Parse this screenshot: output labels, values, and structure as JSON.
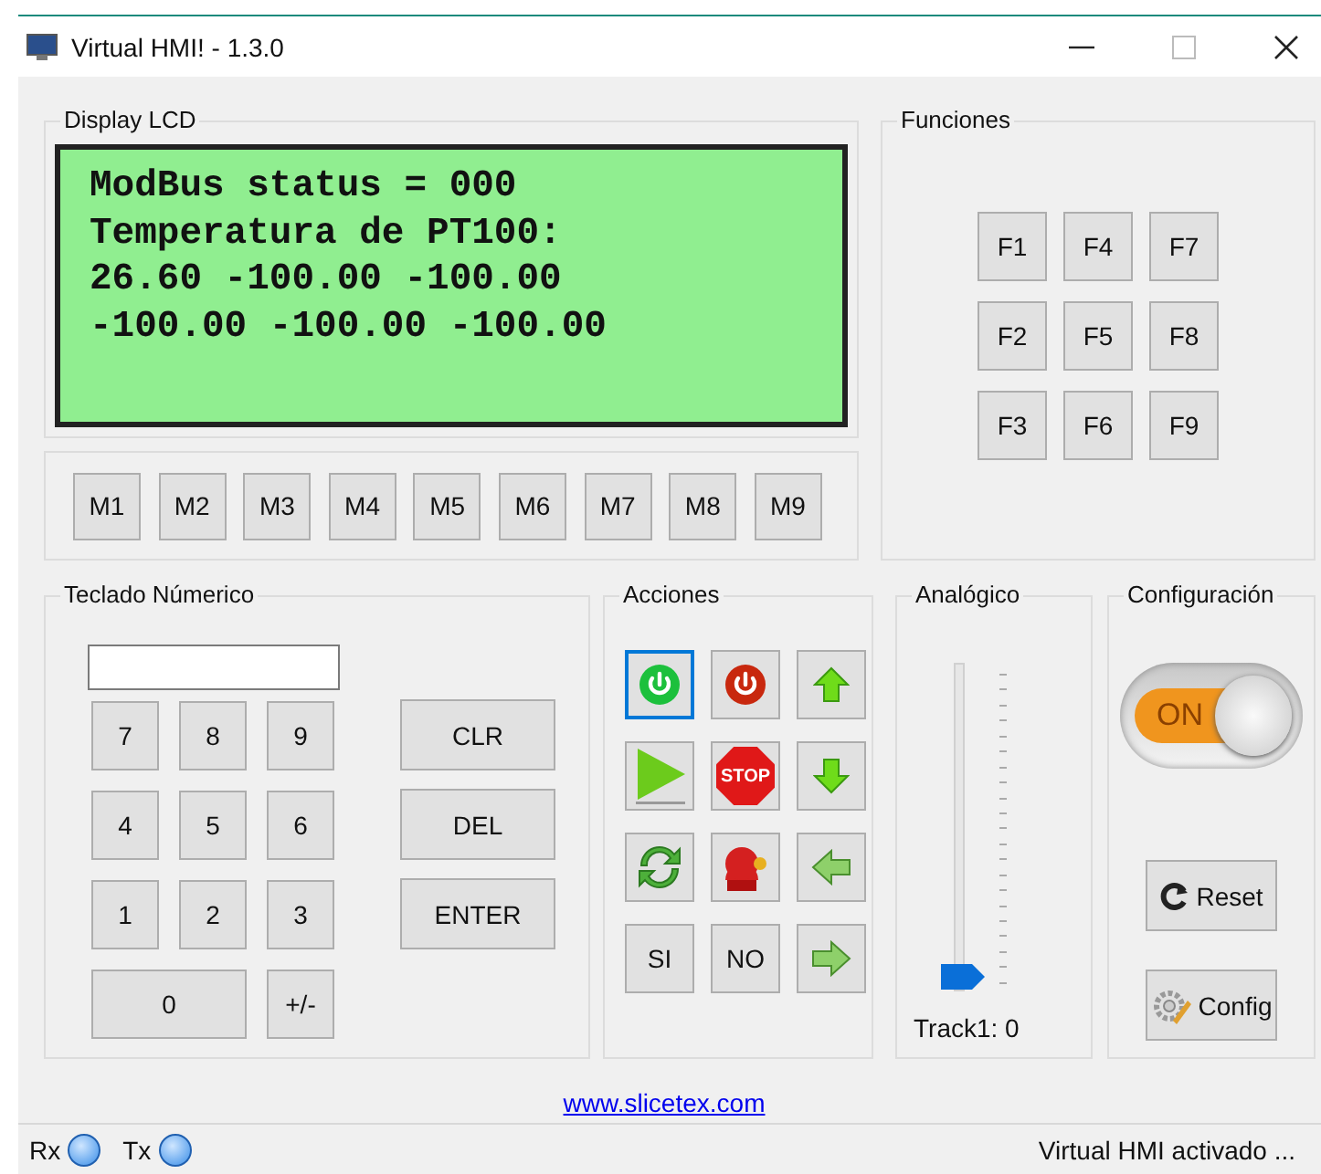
{
  "window": {
    "title": "Virtual HMI! - 1.3.0"
  },
  "display": {
    "title": "Display LCD",
    "lines": [
      "ModBus status = 000",
      "Temperatura de PT100:",
      "26.60 -100.00 -100.00",
      "-100.00 -100.00 -100.00"
    ]
  },
  "memory_buttons": [
    "M1",
    "M2",
    "M3",
    "M4",
    "M5",
    "M6",
    "M7",
    "M8",
    "M9"
  ],
  "functions": {
    "title": "Funciones",
    "buttons": [
      "F1",
      "F4",
      "F7",
      "F2",
      "F5",
      "F8",
      "F3",
      "F6",
      "F9"
    ]
  },
  "keypad": {
    "title": "Teclado Númerico",
    "keys": [
      {
        "label": "7",
        "wide": false
      },
      {
        "label": "8",
        "wide": false
      },
      {
        "label": "9",
        "wide": false
      },
      {
        "label": "4",
        "wide": false
      },
      {
        "label": "5",
        "wide": false
      },
      {
        "label": "6",
        "wide": false
      },
      {
        "label": "1",
        "wide": false
      },
      {
        "label": "2",
        "wide": false
      },
      {
        "label": "3",
        "wide": false
      },
      {
        "label": "0",
        "wide": true
      },
      {
        "label": "+/-",
        "wide": false
      }
    ],
    "side_keys": [
      "CLR",
      "DEL",
      "ENTER"
    ]
  },
  "actions": {
    "title": "Acciones",
    "buttons": [
      {
        "kind": "power_on",
        "focused": true
      },
      {
        "kind": "power_off",
        "focused": false
      },
      {
        "kind": "up",
        "focused": false
      },
      {
        "kind": "play",
        "focused": false
      },
      {
        "kind": "stop",
        "label": "STOP",
        "focused": false
      },
      {
        "kind": "down",
        "focused": false
      },
      {
        "kind": "refresh",
        "focused": false
      },
      {
        "kind": "alarm",
        "focused": false
      },
      {
        "kind": "left",
        "focused": false
      },
      {
        "kind": "text",
        "label": "SI",
        "focused": false
      },
      {
        "kind": "text",
        "label": "NO",
        "focused": false
      },
      {
        "kind": "right",
        "focused": false
      }
    ]
  },
  "analog": {
    "title": "Analógico",
    "level": 0,
    "reading": "Track1: 0"
  },
  "config": {
    "title": "Configuración",
    "toggle": {
      "on": true,
      "label": "ON"
    },
    "reset": "Reset",
    "config": "Config"
  },
  "link": "www.slicetex.com",
  "status_bar": {
    "rx": "Rx",
    "tx": "Tx",
    "message": "Virtual HMI activado ..."
  }
}
